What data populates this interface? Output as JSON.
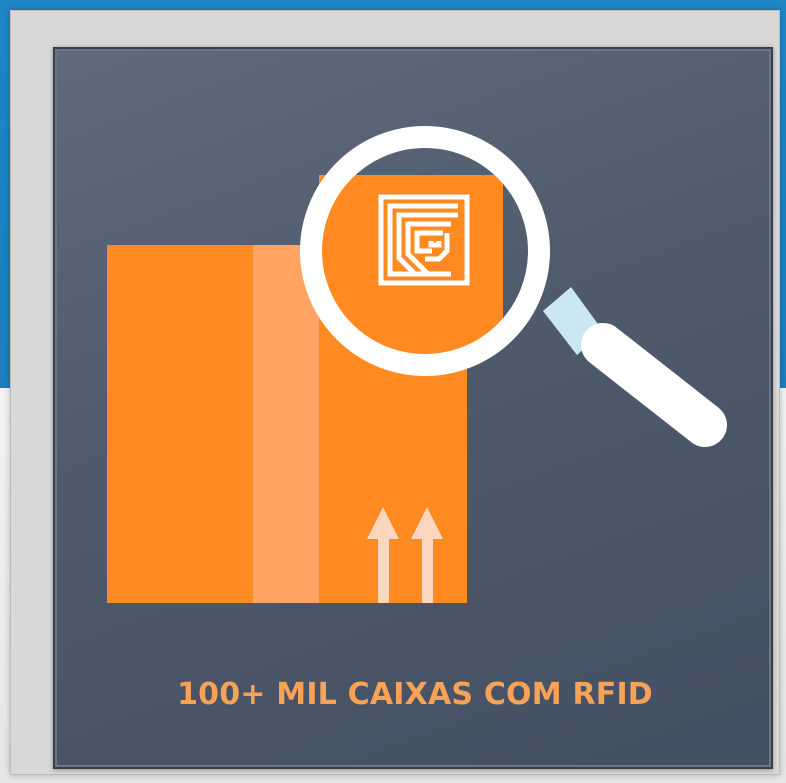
{
  "caption": "100+ MIL CAIXAS COM RFID",
  "icons": {
    "box": "box-icon",
    "rfid_tag": "rfid-tag-icon",
    "magnifier": "magnifying-glass-icon",
    "arrows": "this-side-up-arrows-icon"
  },
  "colors": {
    "box_orange": "#ff8a22",
    "caption": "#f7a256",
    "panel": "#4f5a6b",
    "background_blue": "#1f86c6"
  }
}
